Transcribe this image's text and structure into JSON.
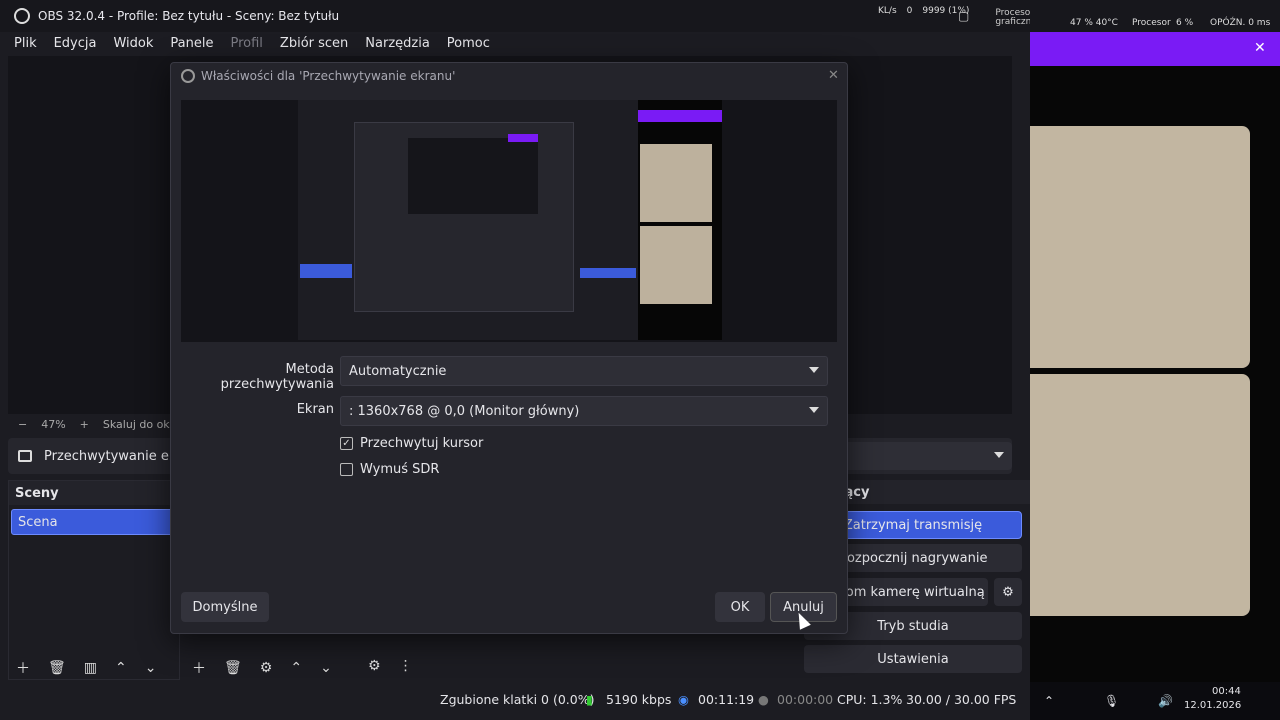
{
  "window": {
    "title": "OBS 32.0.4 - Profile: Bez tytułu - Sceny: Bez tytułu",
    "stats": {
      "kbs": "KL/s",
      "zero": "0",
      "nines": "9999 (1%)",
      "gpu_label": "Procesor graficzny"
    }
  },
  "menu": [
    "Plik",
    "Edycja",
    "Widok",
    "Panele",
    "Profil",
    "Zbiór scen",
    "Narzędzia",
    "Pomoc"
  ],
  "preview": {
    "zoom": "47%",
    "scale_label": "Skaluj do okna"
  },
  "source_bar": {
    "label": "Przechwytywanie ekranu"
  },
  "scenes": {
    "header": "Sceny",
    "items": [
      "Scena"
    ]
  },
  "controls": {
    "header": "Sterujący",
    "stop_stream": "Zatrzymaj transmisję",
    "start_record": "Rozpocznij nagrywanie",
    "virtual_cam": "Uruchom kamerę wirtualną",
    "studio_mode": "Tryb studia",
    "settings": "Ustawienia"
  },
  "status": {
    "dropped": "Zgubione klatki 0 (0.0%)",
    "bitrate": "5190 kbps",
    "stream_time": "00:11:19",
    "record_time": "00:00:00",
    "cpu": "CPU: 1.3%",
    "fps": "30.00 / 30.00 FPS"
  },
  "sidebar": {
    "stats": "47 %  40°C",
    "cpu_label": "Procesor",
    "cpu_val": "6 %",
    "latency": "OPÓŹN. 0 ms",
    "time": "00:44",
    "date": "12.01.2026"
  },
  "dialog": {
    "title": "Właściwości dla 'Przechwytywanie ekranu'",
    "method_label": "Metoda przechwytywania",
    "method_value": "Automatycznie",
    "screen_label": "Ekran",
    "screen_value": ": 1360x768 @ 0,0 (Monitor główny)",
    "capture_cursor": "Przechwytuj kursor",
    "capture_cursor_checked": true,
    "force_sdr": "Wymuś SDR",
    "force_sdr_checked": false,
    "defaults": "Domyślne",
    "ok": "OK",
    "cancel": "Anuluj"
  },
  "colors": {
    "accent": "#3b5bdb",
    "purple": "#7a1bf5",
    "card": "#c2b6a1"
  }
}
